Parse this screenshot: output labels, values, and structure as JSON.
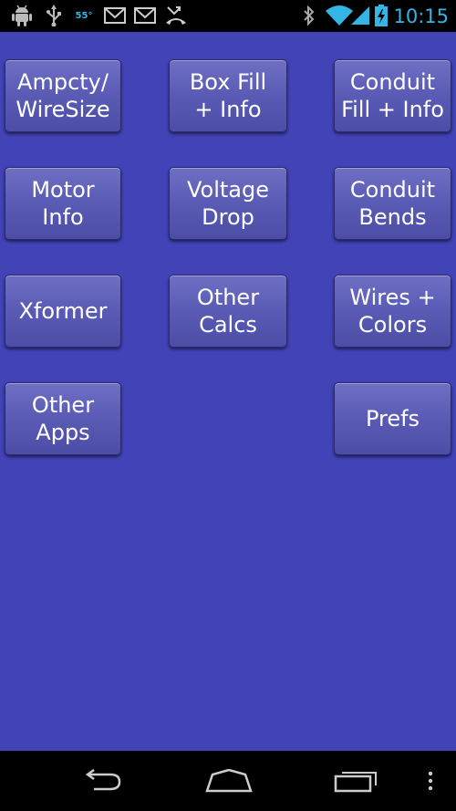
{
  "status_bar": {
    "time": "10:15",
    "temperature": "55°",
    "left_icons": [
      "android-debug-icon",
      "usb-icon",
      "temperature-icon",
      "gmail-icon",
      "gmail-icon",
      "missed-call-icon"
    ],
    "right_icons": [
      "bluetooth-icon",
      "wifi-icon",
      "signal-icon",
      "battery-charging-icon"
    ],
    "accent_color": "#33b5e5"
  },
  "background_color": "#4343b8",
  "buttons": {
    "ampacity": "Ampcty/\nWireSize",
    "box_fill": "Box Fill\n+ Info",
    "conduit_fill": "Conduit\nFill + Info",
    "motor": "Motor\nInfo",
    "voltage_drop": "Voltage\nDrop",
    "conduit_bends": "Conduit\nBends",
    "xformer": "Xformer",
    "other_calcs": "Other\nCalcs",
    "wires_colors": "Wires +\nColors",
    "other_apps": "Other\nApps",
    "prefs": "Prefs"
  },
  "nav_bar": {
    "icons": [
      "back-icon",
      "home-icon",
      "recent-apps-icon",
      "menu-icon"
    ]
  }
}
